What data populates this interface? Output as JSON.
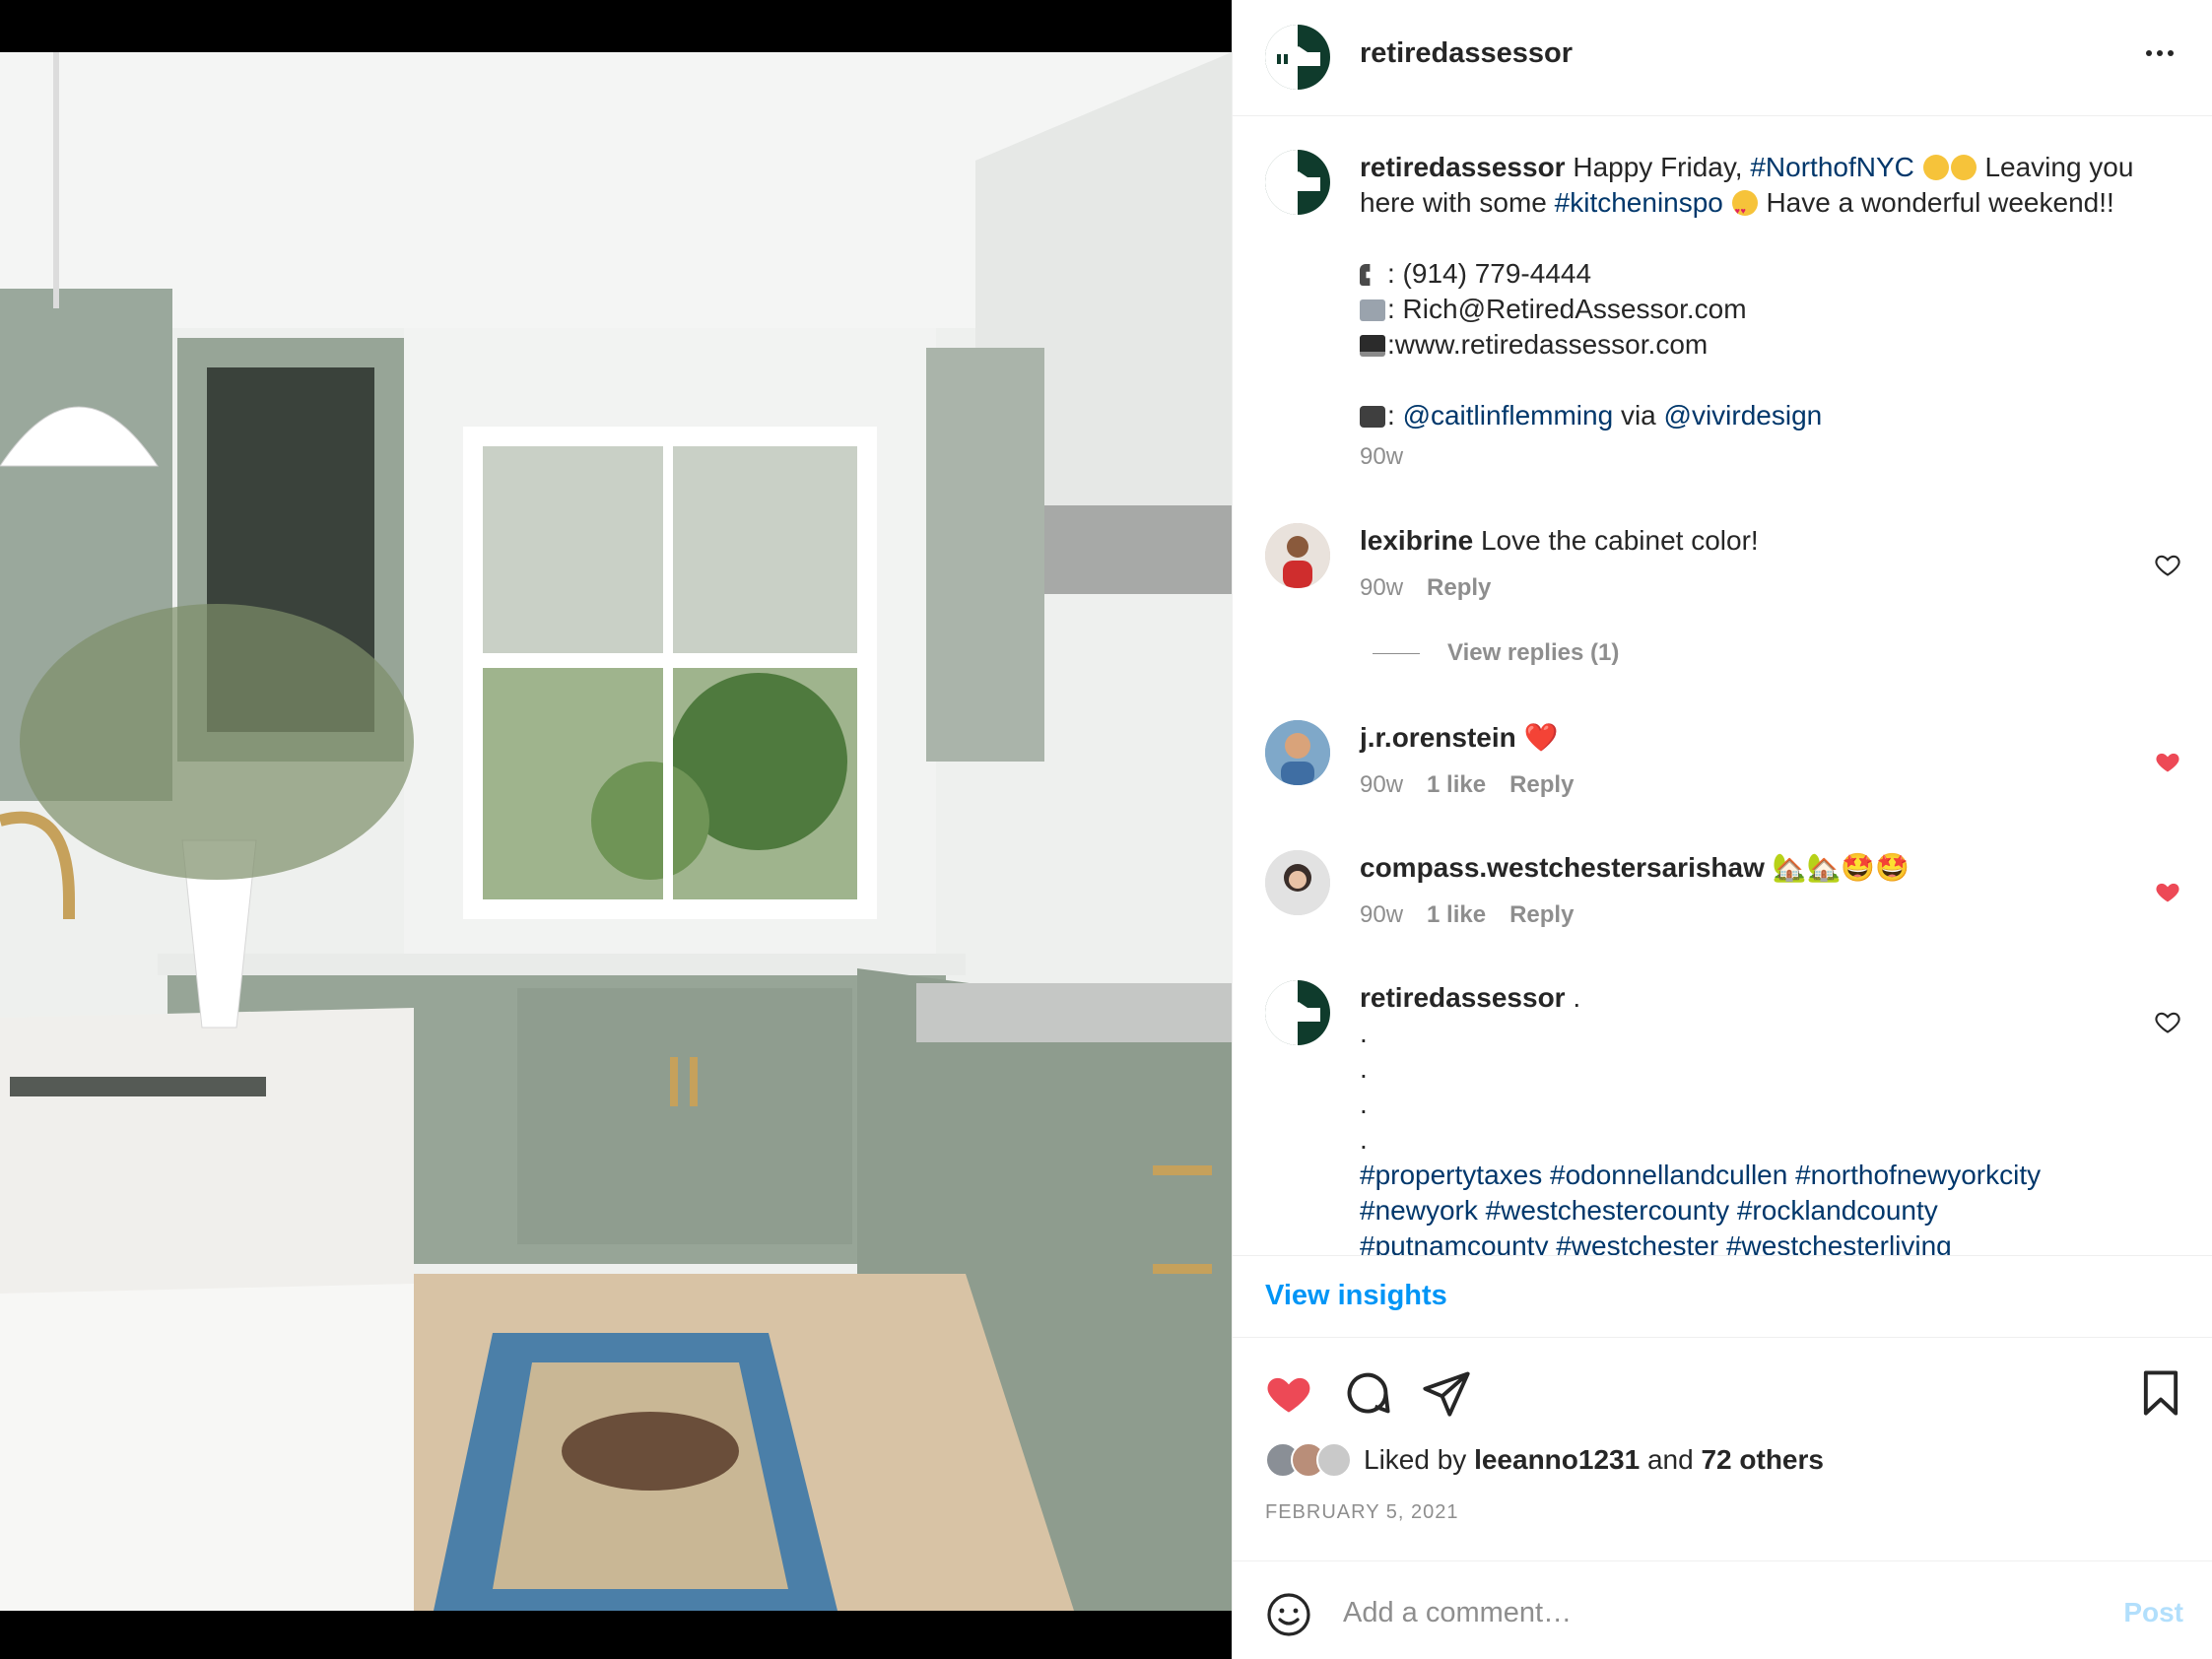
{
  "post": {
    "username": "retiredassessor",
    "more_label": "More options"
  },
  "caption": {
    "username": "retiredassessor",
    "line1_a": "Happy Friday,",
    "hashtag1": "#NorthofNYC",
    "line1_b": "Leaving you here with some",
    "hashtag2": "#kitcheninspo",
    "line1_c": "Have a wonderful weekend!!",
    "phone": ": (914) 779-4444",
    "email": ": Rich@RetiredAssessor.com",
    "website": ":www.retiredassessor.com",
    "photo_prefix": ":",
    "photo_credit": "@caitlinflemming",
    "photo_via": "via",
    "photo_design": "@vivirdesign",
    "time": "90w"
  },
  "comments": [
    {
      "username": "lexibrine",
      "text": "Love the cabinet color!",
      "time": "90w",
      "likes": "",
      "reply": "Reply",
      "liked": false
    },
    {
      "username": "j.r.orenstein",
      "text": "❤️",
      "time": "90w",
      "likes": "1 like",
      "reply": "Reply",
      "liked": true
    },
    {
      "username": "compass.westchestersarishaw",
      "text": "🏡🏡🤩🤩",
      "time": "90w",
      "likes": "1 like",
      "reply": "Reply",
      "liked": true
    },
    {
      "username": "retiredassessor",
      "text": ".",
      "dots": [
        ".",
        ".",
        ".",
        "."
      ],
      "tags_line1": "#propertytaxes #odonnellandcullen #northofnewyorkcity",
      "tags_line2": "#newyork #westchestercounty #rocklandcounty",
      "tags_line3": "#putnamcounty #westchester #westchesterliving",
      "liked": false
    }
  ],
  "view_replies": "View replies (1)",
  "insights": "View insights",
  "likes": {
    "prefix": "Liked by",
    "user": "leeanno1231",
    "and": "and",
    "others": "72 others"
  },
  "date": "FEBRUARY 5, 2021",
  "add_comment": {
    "placeholder": "Add a comment…",
    "post_label": "Post"
  },
  "colors": {
    "link": "#00376b",
    "accent_blue": "#0095f6",
    "like_red": "#ed4956",
    "cabinet_sage": "#9aa89c",
    "brand_green": "#0f3b2c"
  }
}
